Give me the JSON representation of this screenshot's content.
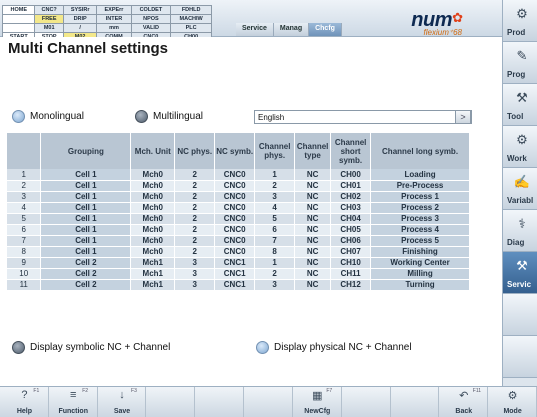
{
  "status_grid": [
    [
      {
        "t": "HOME",
        "c": "wh"
      },
      {
        "t": "CNC?",
        "c": "lb"
      },
      {
        "t": "SYSIRr",
        "c": "lb"
      },
      {
        "t": "EXPErr",
        "c": "lb"
      },
      {
        "t": "COLDET",
        "c": "lb"
      },
      {
        "t": "FDHLD",
        "c": "lb"
      }
    ],
    [
      {
        "t": "",
        "c": "wh"
      },
      {
        "t": "FREE",
        "c": "hl"
      },
      {
        "t": "DRIP",
        "c": "lb"
      },
      {
        "t": "INTER",
        "c": "lb"
      },
      {
        "t": "NPOS",
        "c": "lb"
      },
      {
        "t": "MACHIW",
        "c": "lb"
      }
    ],
    [
      {
        "t": "",
        "c": "wh"
      },
      {
        "t": "M01",
        "c": "lb"
      },
      {
        "t": "/",
        "c": "lb"
      },
      {
        "t": "mm",
        "c": "lb"
      },
      {
        "t": "VALID",
        "c": "lb"
      },
      {
        "t": "PLC",
        "c": "lb"
      }
    ],
    [
      {
        "t": "START",
        "c": "wh"
      },
      {
        "t": "STOP",
        "c": "wh"
      },
      {
        "t": "M02",
        "c": "hl"
      },
      {
        "t": "COMM",
        "c": "lb"
      },
      {
        "t": "CNC0",
        "c": "lb"
      },
      {
        "t": "CH00",
        "c": "lb"
      }
    ]
  ],
  "logo": {
    "brand": "num",
    "tagline": "flexium⁺68"
  },
  "breadcrumbs": [
    "Service",
    "Manag",
    "Chcfg"
  ],
  "sidebar": [
    {
      "label": "Prod",
      "icon": "gears-icon",
      "glyph": "⚙"
    },
    {
      "label": "Prog",
      "icon": "program-icon",
      "glyph": "✎"
    },
    {
      "label": "Tool",
      "icon": "tool-icon",
      "glyph": "⚒"
    },
    {
      "label": "Work",
      "icon": "workpiece-icon",
      "glyph": "⚙"
    },
    {
      "label": "Variabl",
      "icon": "variables-icon",
      "glyph": "✍"
    },
    {
      "label": "Diag",
      "icon": "diagnosis-icon",
      "glyph": "⚕"
    },
    {
      "label": "Servic",
      "icon": "service-icon",
      "glyph": "⚒"
    },
    {
      "label": "",
      "icon": "",
      "glyph": ""
    },
    {
      "label": "",
      "icon": "",
      "glyph": ""
    }
  ],
  "title": "Multi Channel settings",
  "lang_mode": {
    "mono": "Monolingual",
    "multi": "Multilingual",
    "selected": "multi"
  },
  "language": {
    "value": "English",
    "arrow": ">"
  },
  "table": {
    "headers": [
      "",
      "Grouping",
      "Mch. Unit",
      "NC phys.",
      "NC symb.",
      "Channel phys.",
      "Channel type",
      "Channel short symb.",
      "Channel long symb."
    ],
    "rows": [
      [
        "1",
        "Cell 1",
        "Mch0",
        "2",
        "CNC0",
        "1",
        "NC",
        "CH00",
        "Loading"
      ],
      [
        "2",
        "Cell 1",
        "Mch0",
        "2",
        "CNC0",
        "2",
        "NC",
        "CH01",
        "Pre-Process"
      ],
      [
        "3",
        "Cell 1",
        "Mch0",
        "2",
        "CNC0",
        "3",
        "NC",
        "CH02",
        "Process 1"
      ],
      [
        "4",
        "Cell 1",
        "Mch0",
        "2",
        "CNC0",
        "4",
        "NC",
        "CH03",
        "Process 2"
      ],
      [
        "5",
        "Cell 1",
        "Mch0",
        "2",
        "CNC0",
        "5",
        "NC",
        "CH04",
        "Process 3"
      ],
      [
        "6",
        "Cell 1",
        "Mch0",
        "2",
        "CNC0",
        "6",
        "NC",
        "CH05",
        "Process 4"
      ],
      [
        "7",
        "Cell 1",
        "Mch0",
        "2",
        "CNC0",
        "7",
        "NC",
        "CH06",
        "Process 5"
      ],
      [
        "8",
        "Cell 1",
        "Mch0",
        "2",
        "CNC0",
        "8",
        "NC",
        "CH07",
        "Finishing"
      ],
      [
        "9",
        "Cell 2",
        "Mch1",
        "3",
        "CNC1",
        "1",
        "NC",
        "CH10",
        "Working Center"
      ],
      [
        "10",
        "Cell 2",
        "Mch1",
        "3",
        "CNC1",
        "2",
        "NC",
        "CH11",
        "Milling"
      ],
      [
        "11",
        "Cell 2",
        "Mch1",
        "3",
        "CNC1",
        "3",
        "NC",
        "CH12",
        "Turning"
      ]
    ]
  },
  "display_mode": {
    "symbolic": "Display symbolic NC + Channel",
    "physical": "Display physical NC + Channel",
    "selected": "symbolic"
  },
  "softkeys": [
    {
      "fn": "F1",
      "label": "Help",
      "icon": "help-icon",
      "glyph": "?"
    },
    {
      "fn": "F2",
      "label": "Function",
      "icon": "function-icon",
      "glyph": "≡"
    },
    {
      "fn": "F3",
      "label": "Save",
      "icon": "save-icon",
      "glyph": "↓"
    },
    {
      "fn": "",
      "label": "",
      "icon": "",
      "glyph": ""
    },
    {
      "fn": "",
      "label": "",
      "icon": "",
      "glyph": ""
    },
    {
      "fn": "",
      "label": "",
      "icon": "",
      "glyph": ""
    },
    {
      "fn": "F7",
      "label": "NewCfg",
      "icon": "new-config-icon",
      "glyph": "▦"
    },
    {
      "fn": "",
      "label": "",
      "icon": "",
      "glyph": ""
    },
    {
      "fn": "",
      "label": "",
      "icon": "",
      "glyph": ""
    },
    {
      "fn": "F11",
      "label": "Back",
      "icon": "back-icon",
      "glyph": "↶"
    },
    {
      "fn": "",
      "label": "Mode",
      "icon": "mode-icon",
      "glyph": "⚙"
    }
  ]
}
